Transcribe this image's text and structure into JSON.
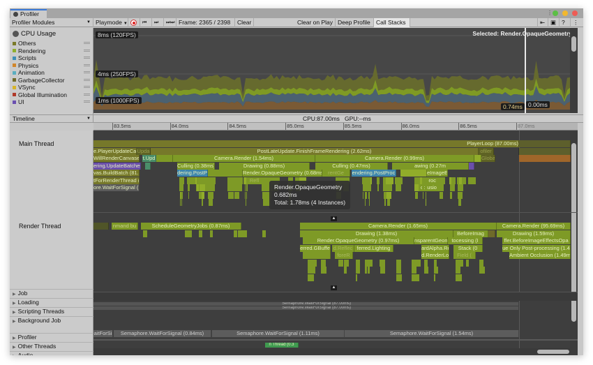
{
  "window": {
    "tab_title": "Profiler",
    "window_controls": [
      "kebab-menu",
      "maximize",
      "minimize",
      "close"
    ]
  },
  "toolbar": {
    "modules_dropdown": "Profiler Modules",
    "target_dropdown": "Playmode",
    "frame_label": "Frame: 2365 / 2398",
    "clear": "Clear",
    "clear_on_play": "Clear on Play",
    "deep_profile": "Deep Profile",
    "call_stacks": "Call Stacks",
    "icons": [
      "record-icon",
      "step-back-icon",
      "step-forward-icon",
      "last-frame-icon",
      "load-icon",
      "save-icon",
      "help-icon",
      "menu-icon"
    ]
  },
  "cpu_module": {
    "title": "CPU Usage",
    "legend": [
      {
        "label": "Others",
        "color": "#7a7a2a"
      },
      {
        "label": "Rendering",
        "color": "#8fae2c"
      },
      {
        "label": "Scripts",
        "color": "#3f8eb6"
      },
      {
        "label": "Physics",
        "color": "#d0852a"
      },
      {
        "label": "Animation",
        "color": "#5aaec0"
      },
      {
        "label": "GarbageCollector",
        "color": "#6f6a2a"
      },
      {
        "label": "VSync",
        "color": "#d6b42a"
      },
      {
        "label": "Global Illumination",
        "color": "#b03a2a"
      },
      {
        "label": "UI",
        "color": "#6a4fb0"
      }
    ],
    "chart_labels": [
      "8ms (120FPS)",
      "4ms (250FPS)",
      "1ms (1000FPS)"
    ],
    "selected_label": "Selected: Render.OpaqueGeometry",
    "cursor_values": [
      "0.74ms",
      "0.00ms"
    ]
  },
  "timeline": {
    "view_dropdown": "Timeline",
    "cpu_gpu": "CPU:87.00ms   GPU:--ms",
    "ruler_ticks": [
      "83.5ms",
      "84.0ms",
      "84.5ms",
      "85.0ms",
      "85.5ms",
      "86.0ms",
      "86.5ms",
      "87.0ms"
    ],
    "threads": [
      "Main Thread",
      "Render Thread"
    ],
    "groups": [
      "Job",
      "Loading",
      "Scripting Threads",
      "Background Job",
      "Profiler",
      "Other Threads",
      "Audio"
    ],
    "main_thread_blocks": {
      "row0": [
        "PlayerLoop (87.00ms)"
      ],
      "row1": [
        "e.PlayerUpdateCanv",
        "Upda",
        "PostLateUpdate.FinishFrameRendering (2.62ms)",
        "ofiler"
      ],
      "row2": [
        "WillRenderCanvases",
        "t.Upd",
        "Camera.Render (1.54ms)",
        "Camera.Render (0.99ms)",
        "Globa"
      ],
      "row3": [
        "ering.UpdateBatches",
        "Culling (0.38ms)",
        "Drawing (0.88ms)",
        "Culling (0.47ms)",
        "awing (0.27m"
      ],
      "row4": [
        "vas.BuildBatch (81.8",
        "dering.PostPr",
        "Render.OpaqueGeometry (0.68ms)",
        "rentGe",
        "endering.PostProc",
        "eImageE"
      ],
      "row5": [
        "tForRenderThread (",
        "Reflec",
        "st-proc"
      ],
      "row6": [
        "ore.WaitForSignal (",
        "cclusio"
      ]
    },
    "tooltip": {
      "name": "Render.OpaqueGeometry",
      "time": "0.682ms",
      "total": "Total: 1.78ms (4 Instances)"
    },
    "render_thread_blocks": {
      "row0": [
        "nmand bu",
        "ScheduleGeometryJobs (0.87ms)",
        "Camera.Render (1.65ms)",
        "Camera.Render (95.69ms)"
      ],
      "row1": [
        "Drawing (1.38ms)",
        "BeforeImag",
        "Drawing (1.59ms)"
      ],
      "row2": [
        "Render.OpaqueGeometry (0.97ms)",
        "nsparentGeome",
        "tocessing (I",
        "ffer.BeforeImageEffectsOpa"
      ],
      "row3": [
        "erred.GBuffe",
        "d.Reflec",
        "ferred.Lighting",
        "ardAlpha.Ren",
        "Stack (0",
        "ue Only Post-processing (1.4"
      ],
      "row4": [
        "foreR",
        "d.RenderLoo",
        "Field (",
        "Ambient Occlusion (1.49ms)"
      ]
    },
    "loading_blocks": [
      "Semaphore.WaitForSignal (87.00ms)",
      "Semaphore.WaitForSignal (87.00ms)"
    ],
    "profiler_blocks": [
      "aitForSi",
      "Semaphore.WaitForSignal (0.84ms)",
      "Semaphore.WaitForSignal (1.11ms)",
      "Semaphore.WaitForSignal (1.54ms)"
    ],
    "audio_blocks": [
      "n Thread (0.3"
    ]
  },
  "chart_data": {
    "type": "area",
    "title": "CPU Usage",
    "ylabel": "ms",
    "reference_lines": [
      {
        "label": "8ms (120FPS)",
        "value": 8
      },
      {
        "label": "4ms (250FPS)",
        "value": 4
      },
      {
        "label": "1ms (1000FPS)",
        "value": 1
      }
    ],
    "series": [
      {
        "name": "Physics",
        "color": "#7a5a35",
        "approx_value": 0.8
      },
      {
        "name": "Scripts",
        "color": "#4b6170",
        "approx_value": 0.9
      },
      {
        "name": "Rendering",
        "color": "#7f9a24",
        "approx_value": 0.6
      },
      {
        "name": "Others",
        "color": "#666a2e",
        "approx_value": 1.3
      }
    ],
    "selected_frame_values": [
      "0.74ms",
      "0.00ms"
    ]
  }
}
